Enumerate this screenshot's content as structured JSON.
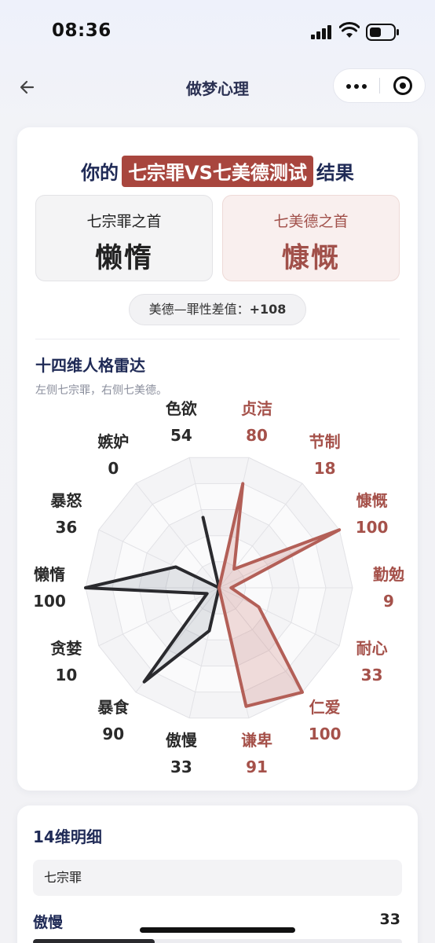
{
  "status": {
    "time": "08:36"
  },
  "nav": {
    "title": "做梦心理"
  },
  "result": {
    "title_prefix": "你的",
    "title_highlight": "七宗罪VS七美德测试",
    "title_suffix": "结果",
    "top_sin_label": "七宗罪之首",
    "top_sin_value": "懒惰",
    "top_virtue_label": "七美德之首",
    "top_virtue_value": "慷慨",
    "diff_label": "美德—罪性差值：",
    "diff_value": "+108"
  },
  "radar": {
    "title": "十四维人格雷达",
    "subtitle": "左侧七宗罪，右侧七美德。",
    "max": 100,
    "colors": {
      "sin": "#2a2a2e",
      "virtue": "#b35f57"
    },
    "dimensions": [
      {
        "name": "贞洁",
        "value": 80,
        "group": "virtue"
      },
      {
        "name": "节制",
        "value": 18,
        "group": "virtue"
      },
      {
        "name": "慷慨",
        "value": 100,
        "group": "virtue"
      },
      {
        "name": "勤勉",
        "value": 9,
        "group": "virtue"
      },
      {
        "name": "耐心",
        "value": 33,
        "group": "virtue"
      },
      {
        "name": "仁爱",
        "value": 100,
        "group": "virtue"
      },
      {
        "name": "谦卑",
        "value": 91,
        "group": "virtue"
      },
      {
        "name": "傲慢",
        "value": 33,
        "group": "sin"
      },
      {
        "name": "暴食",
        "value": 90,
        "group": "sin"
      },
      {
        "name": "贪婪",
        "value": 10,
        "group": "sin"
      },
      {
        "name": "懒惰",
        "value": 100,
        "group": "sin"
      },
      {
        "name": "暴怒",
        "value": 36,
        "group": "sin"
      },
      {
        "name": "嫉妒",
        "value": 0,
        "group": "sin"
      },
      {
        "name": "色欲",
        "value": 54,
        "group": "sin"
      }
    ]
  },
  "detail": {
    "title": "14维明细",
    "group_label": "七宗罪",
    "first_row": {
      "name": "傲慢",
      "value": "33",
      "fraction": 0.33
    }
  }
}
